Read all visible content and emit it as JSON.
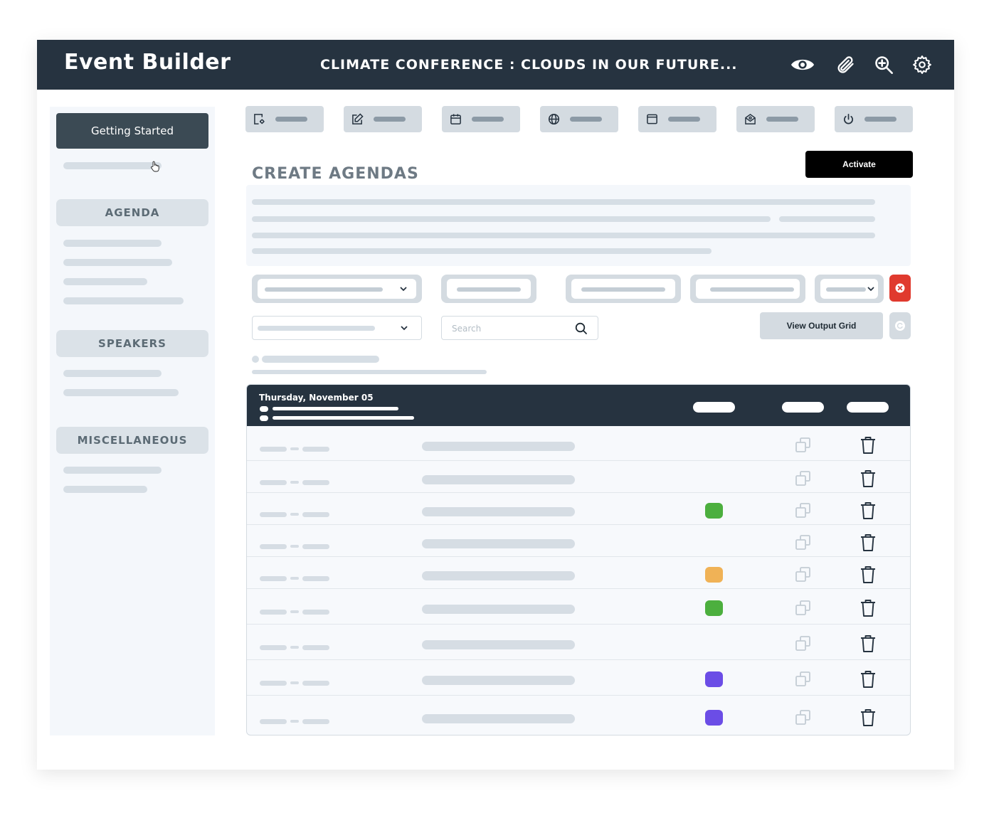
{
  "header": {
    "app_title": "Event Builder",
    "conference_title": "CLIMATE CONFERENCE : CLOUDS IN OUR FUTURE...",
    "icons": [
      "eye-icon",
      "paperclip-icon",
      "zoom-in-icon",
      "gear-icon"
    ]
  },
  "sidebar": {
    "getting_started": "Getting Started",
    "sections": [
      {
        "label": "AGENDA"
      },
      {
        "label": "SPEAKERS"
      },
      {
        "label": "MISCELLANEOUS"
      }
    ]
  },
  "toolbar": {
    "icons": [
      "settings-doc-icon",
      "edit-icon",
      "calendar-icon",
      "globe-icon",
      "window-icon",
      "email-icon",
      "power-icon"
    ]
  },
  "main": {
    "heading": "CREATE AGENDAS",
    "activate_label": "Activate",
    "search_placeholder": "Search",
    "view_output_grid": "View Output Grid"
  },
  "table": {
    "date_header": "Thursday, November 05",
    "rows": [
      {
        "status": null
      },
      {
        "status": null
      },
      {
        "status": "green"
      },
      {
        "status": null
      },
      {
        "status": "orange"
      },
      {
        "status": "green"
      },
      {
        "status": null
      },
      {
        "status": "purple"
      },
      {
        "status": "purple"
      }
    ]
  },
  "colors": {
    "header_bg": "#263340",
    "green": "#4caf3e",
    "orange": "#f0b256",
    "purple": "#6b4de6",
    "danger": "#e03a2e"
  }
}
